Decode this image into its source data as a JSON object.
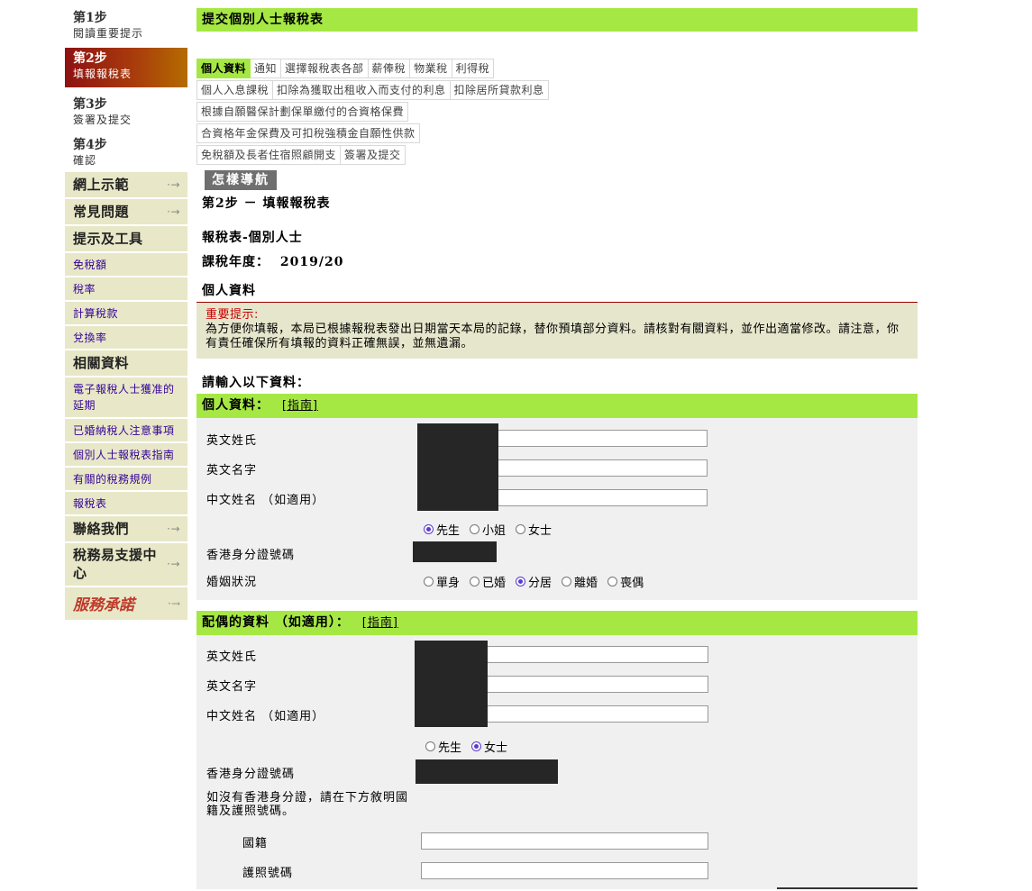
{
  "sidebar": {
    "steps": [
      {
        "title": "第1步",
        "sub": "閱讀重要提示"
      },
      {
        "title": "第2步",
        "sub": "填報報稅表"
      },
      {
        "title": "第3步",
        "sub": "簽署及提交"
      },
      {
        "title": "第4步",
        "sub": "確認"
      }
    ],
    "online_demo": "網上示範",
    "faq": "常見問題",
    "tips_tools": "提示及工具",
    "allowances": "免稅額",
    "tax_rates": "稅率",
    "tax_calc": "計算稅款",
    "exchange": "兌換率",
    "related": "相關資料",
    "extension": "電子報稅人士獲准的延期",
    "married_notes": "已婚納稅人注意事項",
    "guide": "個別人士報稅表指南",
    "rules": "有關的稅務規例",
    "return": "報稅表",
    "contact": "聯絡我們",
    "centre": "稅務易支援中心",
    "pledge": "服務承諾"
  },
  "main": {
    "title": "提交個別人士報稅表",
    "tabs_row1": [
      "個人資料",
      "通知",
      "選擇報稅表各部",
      "薪俸稅",
      "物業稅",
      "利得稅"
    ],
    "tabs_row2": [
      "個人入息課稅",
      "扣除為獲取出租收入而支付的利息",
      "扣除居所貸款利息"
    ],
    "tabs_row3": [
      "根據自願醫保計劃保單繳付的合資格保費"
    ],
    "tabs_row4": [
      "合資格年金保費及可扣稅強積金自願性供款"
    ],
    "tabs_row5": [
      "免稅額及長者住宿照顧開支",
      "簽署及提交"
    ],
    "how_to_nav": "怎樣導航",
    "step_heading": "第2步 － 填報報稅表",
    "form_name": "報稅表-個別人士",
    "year_label": "課稅年度：",
    "year_value": "2019/20",
    "personal_section": "個人資料",
    "notice_label": "重要提示:",
    "notice_text": "為方便你填報，本局已根據報稅表發出日期當天本局的記錄，替你預填部分資料。請核對有關資料，並作出適當修改。請注意，你有責任確保所有填報的資料正確無誤，並無遺漏。",
    "please_enter": "請輸入以下資料："
  },
  "personal": {
    "head": "個人資料：",
    "guide_link": "[指南]",
    "surname": "英文姓氏",
    "given": "英文名字",
    "chinese": "中文姓名 （如適用）",
    "titles": [
      "先生",
      "小姐",
      "女士"
    ],
    "hkid": "香港身分證號碼",
    "marital_label": "婚姻狀況",
    "marital": [
      "單身",
      "已婚",
      "分居",
      "離婚",
      "喪偶"
    ]
  },
  "spouse": {
    "head": "配偶的資料 （如適用）：",
    "guide_link": "[指南]",
    "surname": "英文姓氏",
    "given": "英文名字",
    "chinese": "中文姓名 （如適用）",
    "titles": [
      "先生",
      "女士"
    ],
    "hkid": "香港身分證號碼",
    "no_hkid_note": "如沒有香港身分證，請在下方敘明國籍及護照號碼。",
    "nationality": "國籍",
    "passport": "護照號碼"
  }
}
